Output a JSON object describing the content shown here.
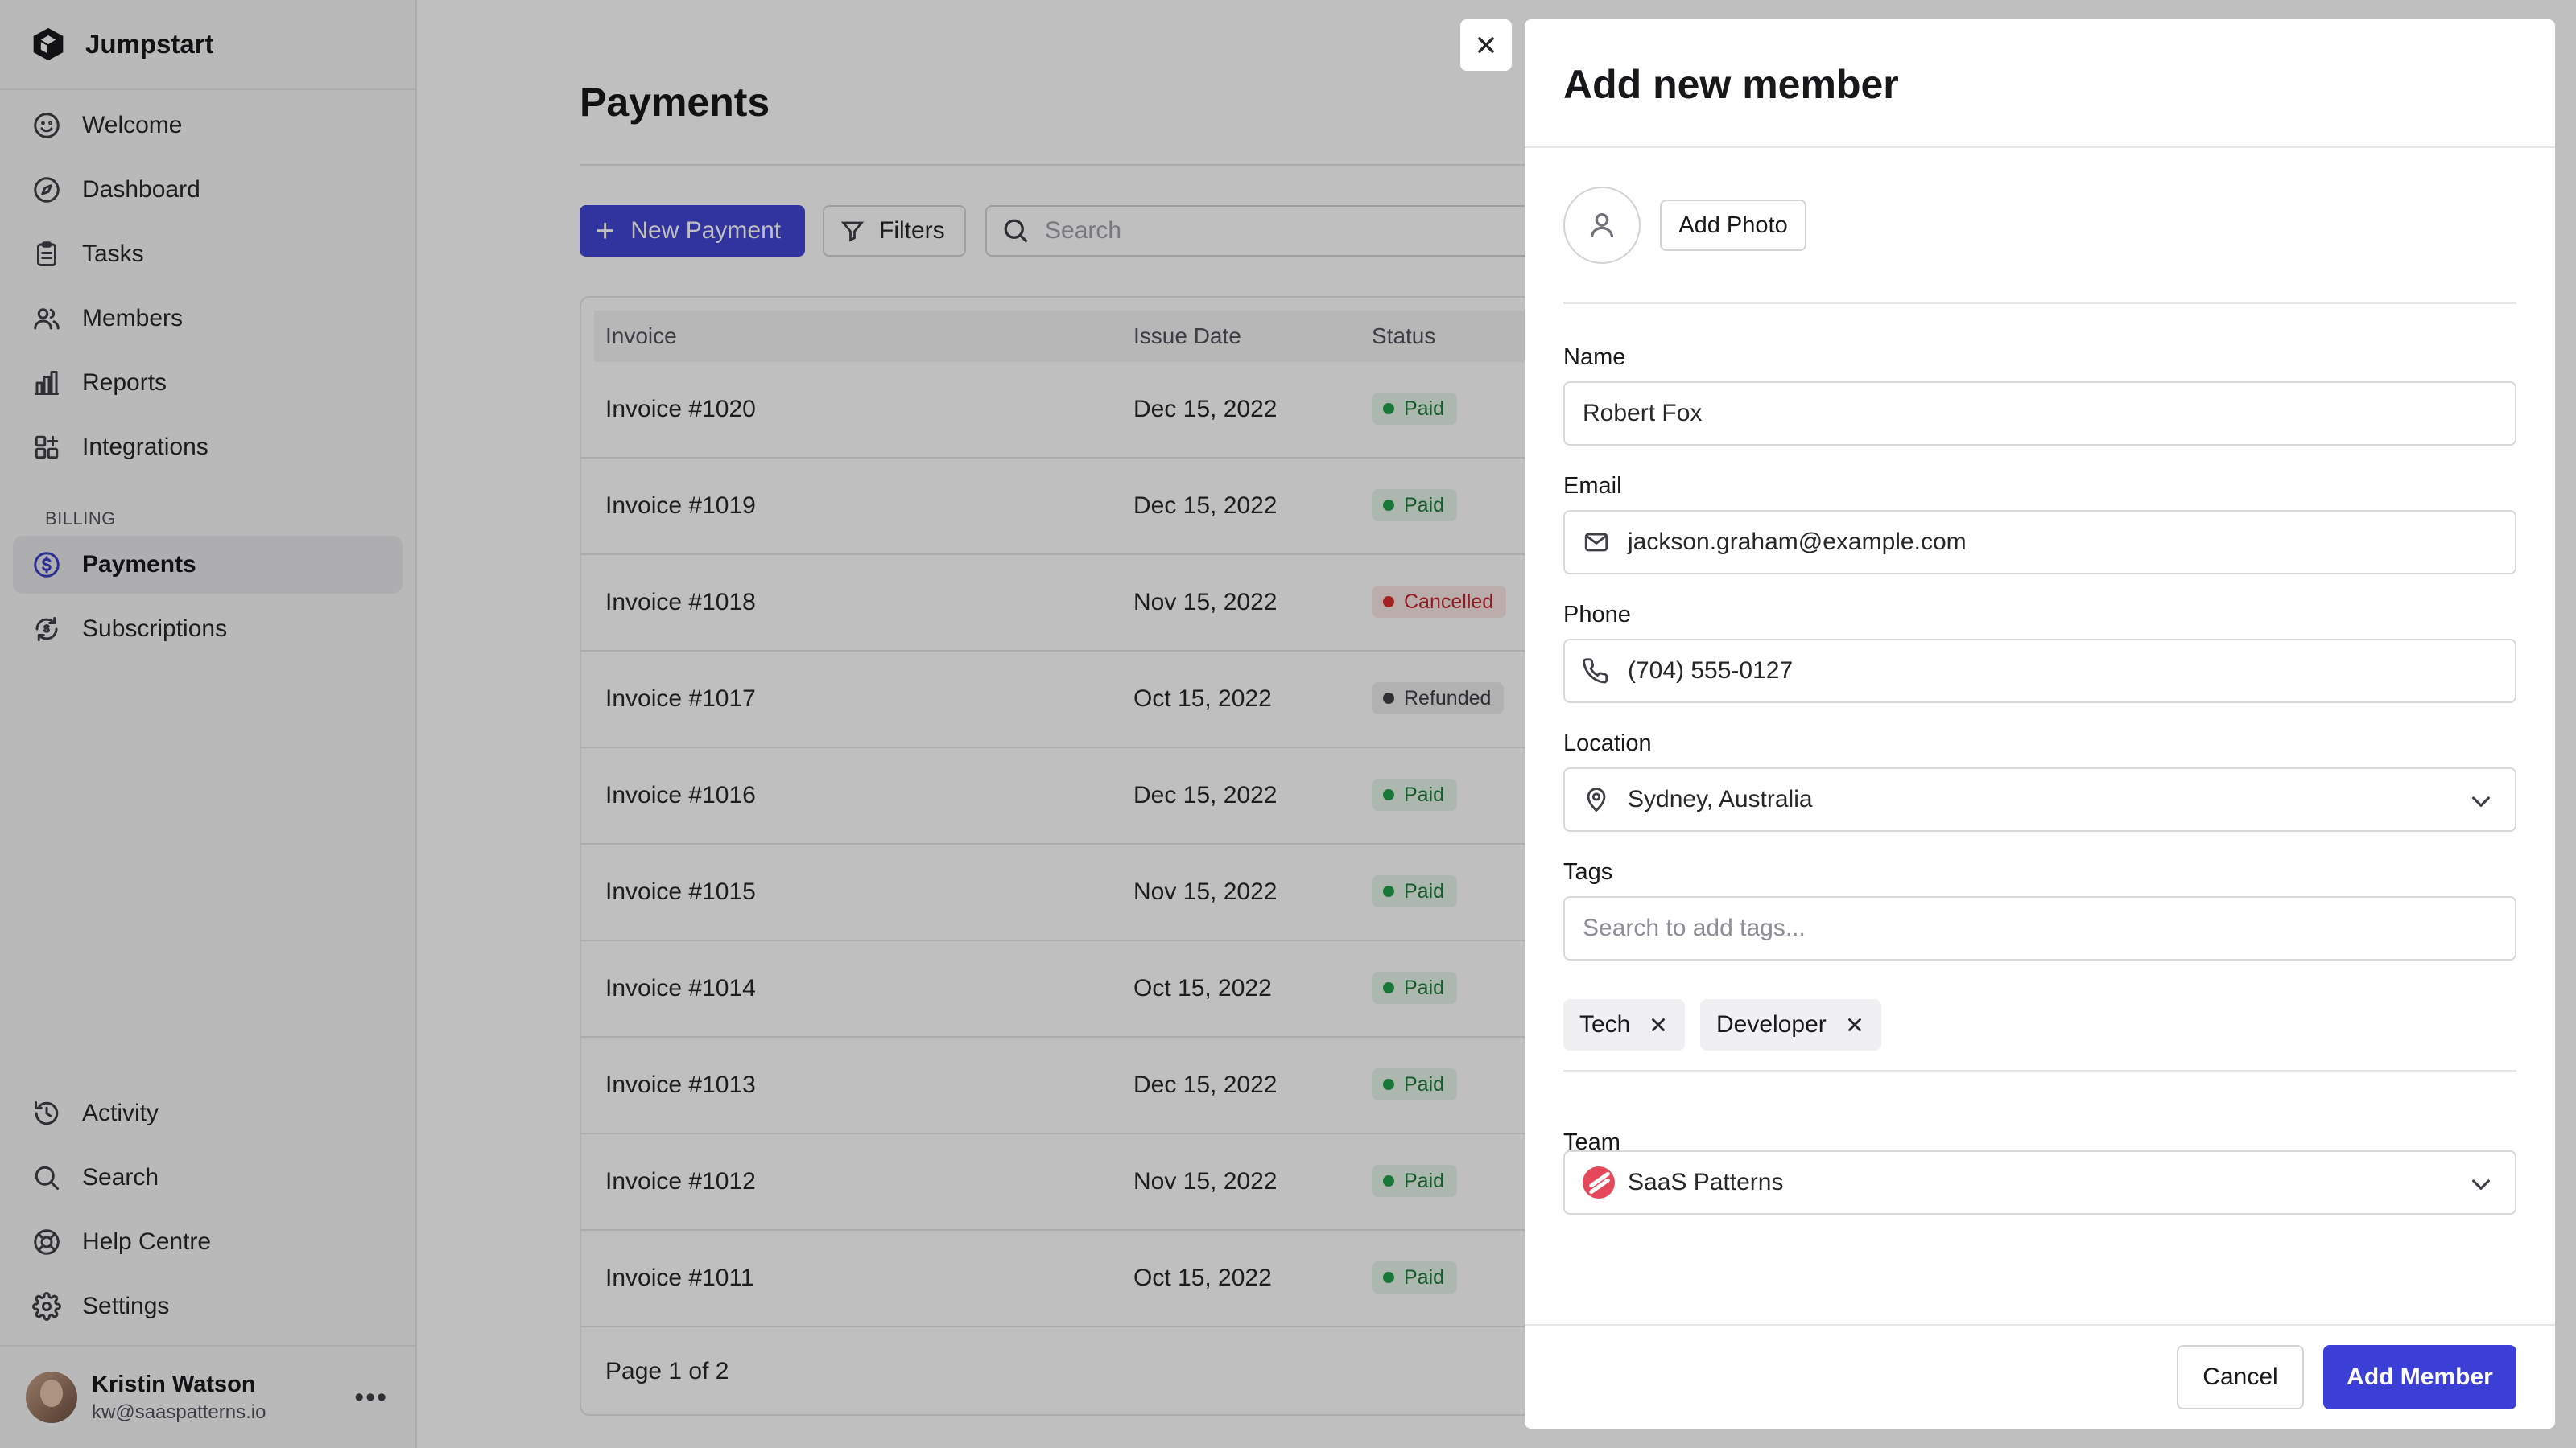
{
  "app": {
    "name": "Jumpstart"
  },
  "sidebar": {
    "items": [
      {
        "label": "Welcome",
        "icon": "smile-icon"
      },
      {
        "label": "Dashboard",
        "icon": "compass-icon"
      },
      {
        "label": "Tasks",
        "icon": "clipboard-icon"
      },
      {
        "label": "Members",
        "icon": "users-icon"
      },
      {
        "label": "Reports",
        "icon": "bar-chart-icon"
      },
      {
        "label": "Integrations",
        "icon": "grid-plus-icon"
      }
    ],
    "billing_section": "BILLING",
    "billing_items": [
      {
        "label": "Payments",
        "icon": "dollar-circle-icon",
        "active": true
      },
      {
        "label": "Subscriptions",
        "icon": "refresh-dollar-icon"
      }
    ],
    "bottom_items": [
      {
        "label": "Activity",
        "icon": "history-icon"
      },
      {
        "label": "Search",
        "icon": "search-icon"
      },
      {
        "label": "Help Centre",
        "icon": "lifebuoy-icon"
      },
      {
        "label": "Settings",
        "icon": "gear-icon"
      }
    ],
    "user": {
      "name": "Kristin Watson",
      "email": "kw@saaspatterns.io"
    }
  },
  "main": {
    "title": "Payments",
    "new_payment_label": "New Payment",
    "filters_label": "Filters",
    "search_placeholder": "Search",
    "columns": [
      "Invoice",
      "Issue Date",
      "Status"
    ],
    "rows": [
      {
        "invoice": "Invoice #1020",
        "date": "Dec 15, 2022",
        "status": "Paid"
      },
      {
        "invoice": "Invoice #1019",
        "date": "Dec 15, 2022",
        "status": "Paid"
      },
      {
        "invoice": "Invoice #1018",
        "date": "Nov 15, 2022",
        "status": "Cancelled"
      },
      {
        "invoice": "Invoice #1017",
        "date": "Oct 15, 2022",
        "status": "Refunded"
      },
      {
        "invoice": "Invoice #1016",
        "date": "Dec 15, 2022",
        "status": "Paid"
      },
      {
        "invoice": "Invoice #1015",
        "date": "Nov 15, 2022",
        "status": "Paid"
      },
      {
        "invoice": "Invoice #1014",
        "date": "Oct 15, 2022",
        "status": "Paid"
      },
      {
        "invoice": "Invoice #1013",
        "date": "Dec 15, 2022",
        "status": "Paid"
      },
      {
        "invoice": "Invoice #1012",
        "date": "Nov 15, 2022",
        "status": "Paid"
      },
      {
        "invoice": "Invoice #1011",
        "date": "Oct 15, 2022",
        "status": "Paid"
      }
    ],
    "pagination": "Page 1 of 2"
  },
  "drawer": {
    "title": "Add new member",
    "add_photo_label": "Add Photo",
    "name_label": "Name",
    "name_value": "Robert Fox",
    "email_label": "Email",
    "email_value": "jackson.graham@example.com",
    "phone_label": "Phone",
    "phone_value": "(704) 555-0127",
    "location_label": "Location",
    "location_value": "Sydney, Australia",
    "tags_label": "Tags",
    "tags_placeholder": "Search to add tags...",
    "tags": [
      "Tech",
      "Developer"
    ],
    "team_label": "Team",
    "team_value": "SaaS Patterns",
    "cancel_label": "Cancel",
    "submit_label": "Add Member"
  },
  "colors": {
    "accent": "#4244d4",
    "paid": "#22a04a",
    "cancelled": "#d92d2d",
    "refunded": "#3f3f46",
    "overlay": "rgba(0,0,0,0.25)"
  }
}
